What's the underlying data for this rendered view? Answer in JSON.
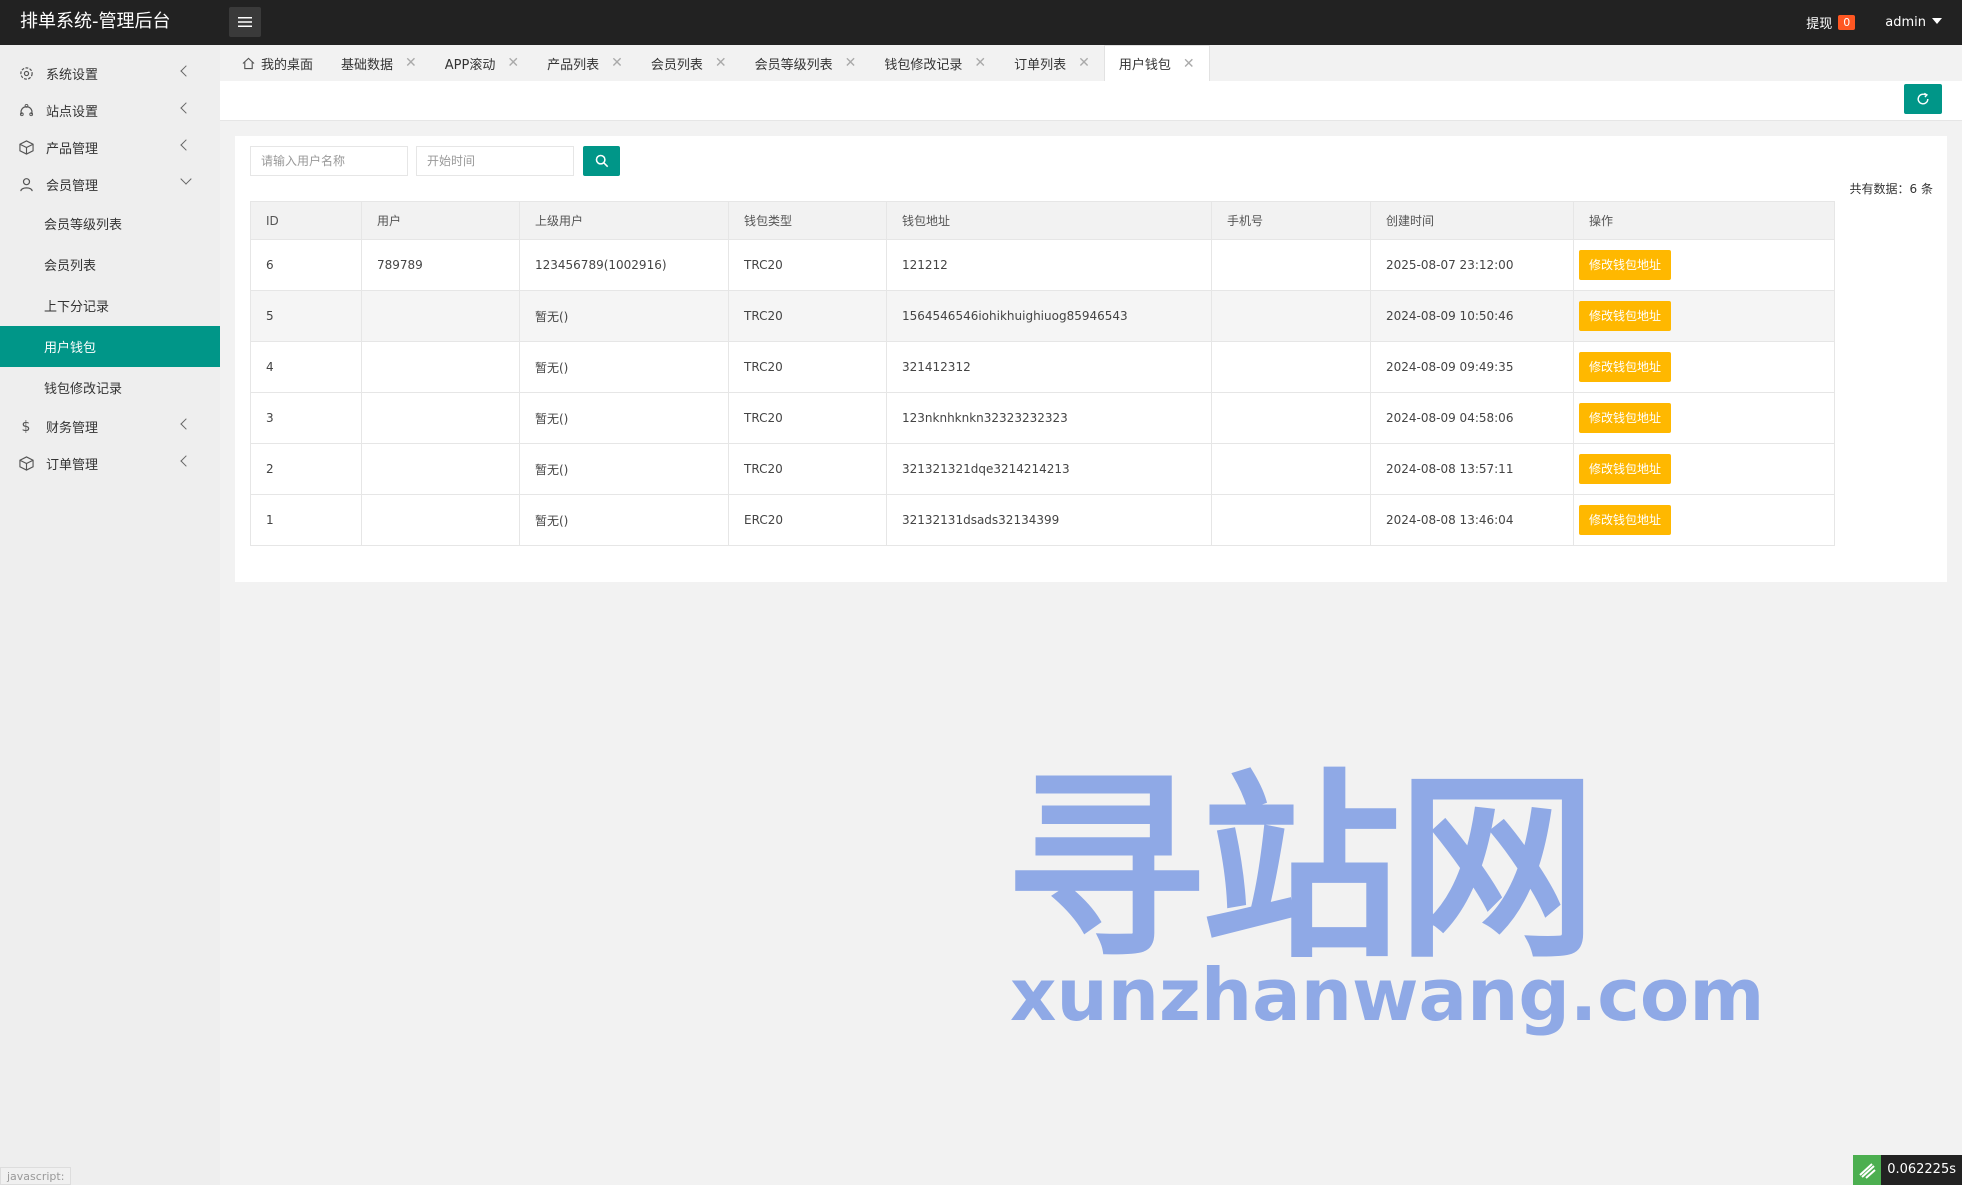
{
  "header": {
    "title": "排单系统-管理后台",
    "withdraw_label": "提现",
    "withdraw_count": "0",
    "user": "admin"
  },
  "sidebar": {
    "items": [
      {
        "label": "系统设置",
        "icon": "gear-icon"
      },
      {
        "label": "站点设置",
        "icon": "site-icon"
      },
      {
        "label": "产品管理",
        "icon": "box-icon"
      },
      {
        "label": "会员管理",
        "icon": "user-icon"
      }
    ],
    "sub_items": [
      "会员等级列表",
      "会员列表",
      "上下分记录",
      "用户钱包",
      "钱包修改记录"
    ],
    "items_after": [
      {
        "label": "财务管理",
        "icon": "dollar-icon"
      },
      {
        "label": "订单管理",
        "icon": "box-icon"
      }
    ]
  },
  "tabs": [
    {
      "label": "我的桌面"
    },
    {
      "label": "基础数据"
    },
    {
      "label": "APP滚动"
    },
    {
      "label": "产品列表"
    },
    {
      "label": "会员列表"
    },
    {
      "label": "会员等级列表"
    },
    {
      "label": "钱包修改记录"
    },
    {
      "label": "订单列表"
    },
    {
      "label": "用户钱包"
    }
  ],
  "search": {
    "username_placeholder": "请输入用户名称",
    "start_placeholder": "开始时间"
  },
  "total_text": "共有数据：6 条",
  "table": {
    "headers": [
      "ID",
      "用户",
      "上级用户",
      "钱包类型",
      "钱包地址",
      "手机号",
      "创建时间",
      "操作"
    ],
    "rows": [
      {
        "id": "6",
        "user": "789789",
        "parent": "123456789(1002916)",
        "type": "TRC20",
        "address": "121212",
        "phone": "",
        "created": "2025-08-07 23:12:00",
        "action": "修改钱包地址"
      },
      {
        "id": "5",
        "user": "",
        "parent": "暂无()",
        "type": "TRC20",
        "address": "1564546546iohikhuighiuog85946543",
        "phone": "",
        "created": "2024-08-09 10:50:46",
        "action": "修改钱包地址"
      },
      {
        "id": "4",
        "user": "",
        "parent": "暂无()",
        "type": "TRC20",
        "address": "321412312",
        "phone": "",
        "created": "2024-08-09 09:49:35",
        "action": "修改钱包地址"
      },
      {
        "id": "3",
        "user": "",
        "parent": "暂无()",
        "type": "TRC20",
        "address": "123nknhknkn32323232323",
        "phone": "",
        "created": "2024-08-09 04:58:06",
        "action": "修改钱包地址"
      },
      {
        "id": "2",
        "user": "",
        "parent": "暂无()",
        "type": "TRC20",
        "address": "321321321dqe3214214213",
        "phone": "",
        "created": "2024-08-08 13:57:11",
        "action": "修改钱包地址"
      },
      {
        "id": "1",
        "user": "",
        "parent": "暂无()",
        "type": "ERC20",
        "address": "32132131dsads32134399",
        "phone": "",
        "created": "2024-08-08 13:46:04",
        "action": "修改钱包地址"
      }
    ]
  },
  "watermark": {
    "cn": "寻站网",
    "en": "xunzhanwang.com"
  },
  "timer": "0.062225s",
  "status_hint": "javascript:",
  "colors": {
    "accent": "#009688",
    "warn": "#ffb800",
    "header": "#222222"
  }
}
